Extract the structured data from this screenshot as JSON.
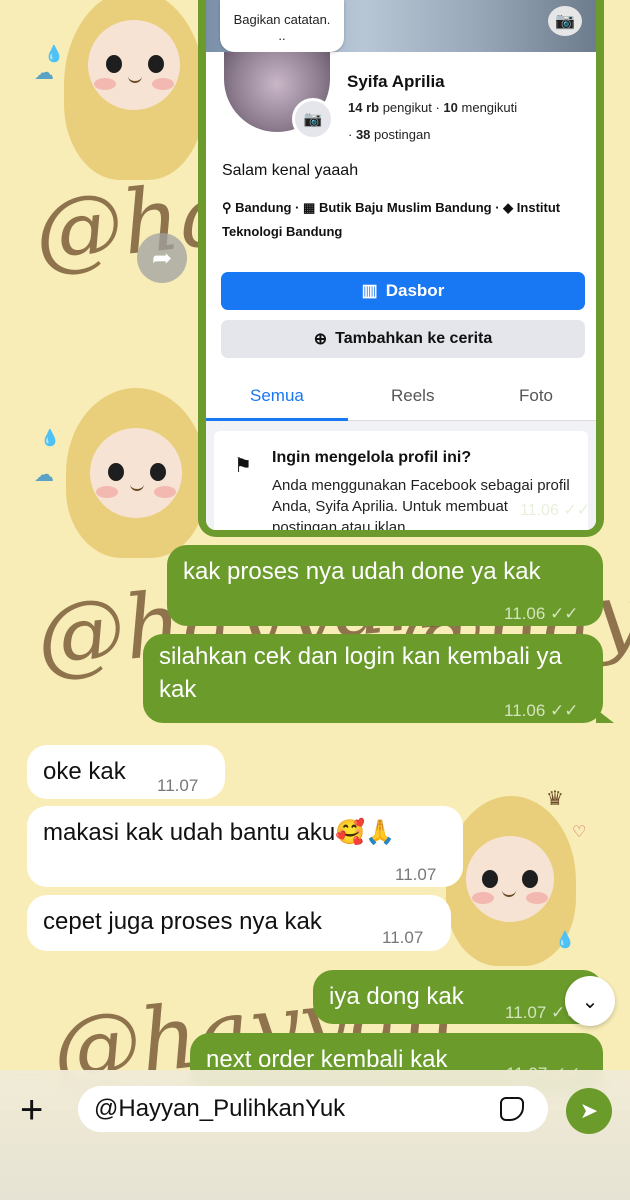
{
  "colors": {
    "outgoing_bubble": "#6a9b2b",
    "incoming_bubble": "#ffffff",
    "wallpaper": "#f8edb6",
    "facebook_blue": "#1877f2"
  },
  "wallpaper": {
    "watermark": "@hayyan"
  },
  "forwarded_screenshot": {
    "note": "Bagikan catatan.\n..",
    "profile": {
      "name": "Syifa Aprilia",
      "followers": "14 rb",
      "followers_label": "pengikut",
      "following": "10",
      "following_label": "mengikuti",
      "posts": "38",
      "posts_label": "postingan",
      "bio": "Salam kenal yaaah",
      "location": "Bandung",
      "work": "Butik Baju Muslim Bandung",
      "education": "Institut Teknologi Bandung"
    },
    "dashboard_button": "Dasbor",
    "add_story_button": "Tambahkan ke cerita",
    "tabs": [
      "Semua",
      "Reels",
      "Foto"
    ],
    "active_tab": "Semua",
    "manage": {
      "title": "Ingin mengelola profil ini?",
      "text": "Anda menggunakan Facebook sebagai profil Anda, Syifa Aprilia. Untuk membuat postingan atau iklan"
    },
    "time": "11.06"
  },
  "messages": [
    {
      "direction": "out",
      "text": "kak proses nya udah done ya kak",
      "time": "11.06",
      "status": "read"
    },
    {
      "direction": "out",
      "text": "silahkan cek dan login kan kembali ya kak",
      "time": "11.06",
      "status": "read"
    },
    {
      "direction": "in",
      "text": "oke kak",
      "time": "11.07"
    },
    {
      "direction": "in",
      "text": "makasi kak udah bantu aku🥰🙏",
      "time": "11.07"
    },
    {
      "direction": "in",
      "text": "cepet juga proses nya kak",
      "time": "11.07"
    },
    {
      "direction": "out",
      "text": "iya dong kak",
      "time": "11.07",
      "status": "read"
    },
    {
      "direction": "out",
      "text": "next order kembali kak",
      "time": "11.07",
      "status": "read"
    }
  ],
  "composer": {
    "value": "@Hayyan_PulihkanYuk",
    "plus_icon": "plus-icon",
    "sticker_icon": "sticker-icon",
    "send_icon": "send-icon"
  }
}
